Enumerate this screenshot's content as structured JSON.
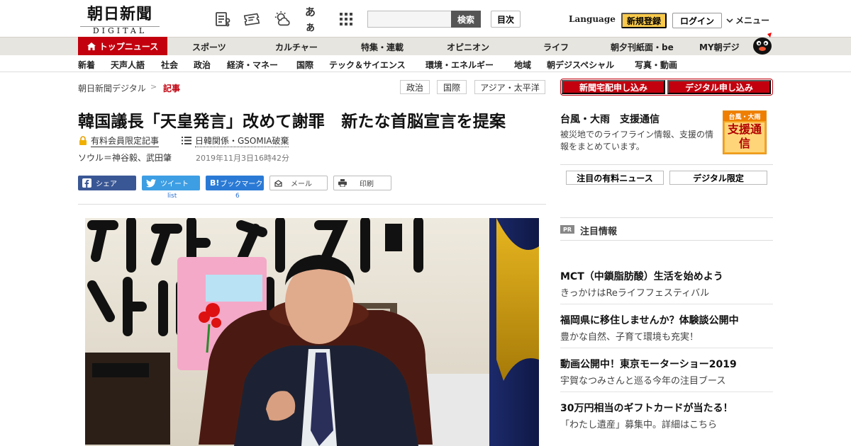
{
  "header": {
    "logo_main": "朝日新聞",
    "logo_sub": "DIGITAL",
    "search_button": "検索",
    "toc_button": "目次",
    "language": "Language",
    "register": "新規登録",
    "login": "ログイン",
    "menu": "メニュー",
    "icons": [
      "news-list-icon",
      "ticket-icon",
      "weather-icon",
      "font-size-icon",
      "grid-icon"
    ],
    "font_size_glyph": "あぁ"
  },
  "nav_primary": {
    "active": "トップニュース",
    "items": [
      "スポーツ",
      "カルチャー",
      "特集・連載",
      "オピニオン",
      "ライフ",
      "朝夕刊紙面・be",
      "MY朝デジ"
    ]
  },
  "nav_secondary": {
    "items": [
      "新着",
      "天声人語",
      "社会",
      "政治",
      "経済・マネー",
      "国際",
      "テック＆サイエンス",
      "環境・エネルギー",
      "地域",
      "朝デジスペシャル",
      "写真・動画"
    ]
  },
  "breadcrumb": {
    "home": "朝日新聞デジタル",
    "separator": ">",
    "current": "記事"
  },
  "tags": [
    "政治",
    "国際",
    "アジア・太平洋"
  ],
  "article": {
    "headline": "韓国議長「天皇発言」改めて謝罪　新たな首脳宣言を提案",
    "member_label": "有料会員限定記事",
    "topic": "日韓関係・GSOMIA破棄",
    "byline": "ソウル＝神谷毅、武田肇",
    "timestamp": "2019年11月3日16時42分"
  },
  "share": {
    "facebook": "シェア",
    "twitter": "ツイート",
    "twitter_count": "list",
    "hatena": "ブックマーク",
    "hatena_glyph": "B!",
    "hatena_count": "6",
    "mail": "メール",
    "print": "印刷"
  },
  "sidebar": {
    "apply_paper": "新聞宅配申し込み",
    "apply_digital": "デジタル申し込み",
    "support_title": "台風・大雨　支援通信",
    "support_desc": "被災地でのライフライン情報、支援の情報をまとめています。",
    "support_badge_top": "台風・大雨",
    "support_badge_main": "支援通信",
    "tab_paid": "注目の有料ニュース",
    "tab_digital": "デジタル限定",
    "pr_badge": "PR",
    "pr_title": "注目情報",
    "ads": [
      {
        "title": "MCT（中鎖脂肪酸）生活を始めよう",
        "desc": "きっかけはReライフフェスティバル"
      },
      {
        "title": "福岡県に移住しませんか？体験談公開中",
        "desc": "豊かな自然、子育て環境も充実！"
      },
      {
        "title": "動画公開中！東京モーターショー2019",
        "desc": "宇賀なつみさんと巡る今年の注目ブース"
      },
      {
        "title": "30万円相当のギフトカードが当たる！",
        "desc": "「わたし遺産」募集中。詳細はこちら"
      }
    ]
  },
  "colors": {
    "brand_red": "#c2000e",
    "register_yellow": "#f8c94a",
    "facebook": "#3a5795",
    "twitter": "#3d9ee3",
    "hatena": "#2a7ad5"
  }
}
